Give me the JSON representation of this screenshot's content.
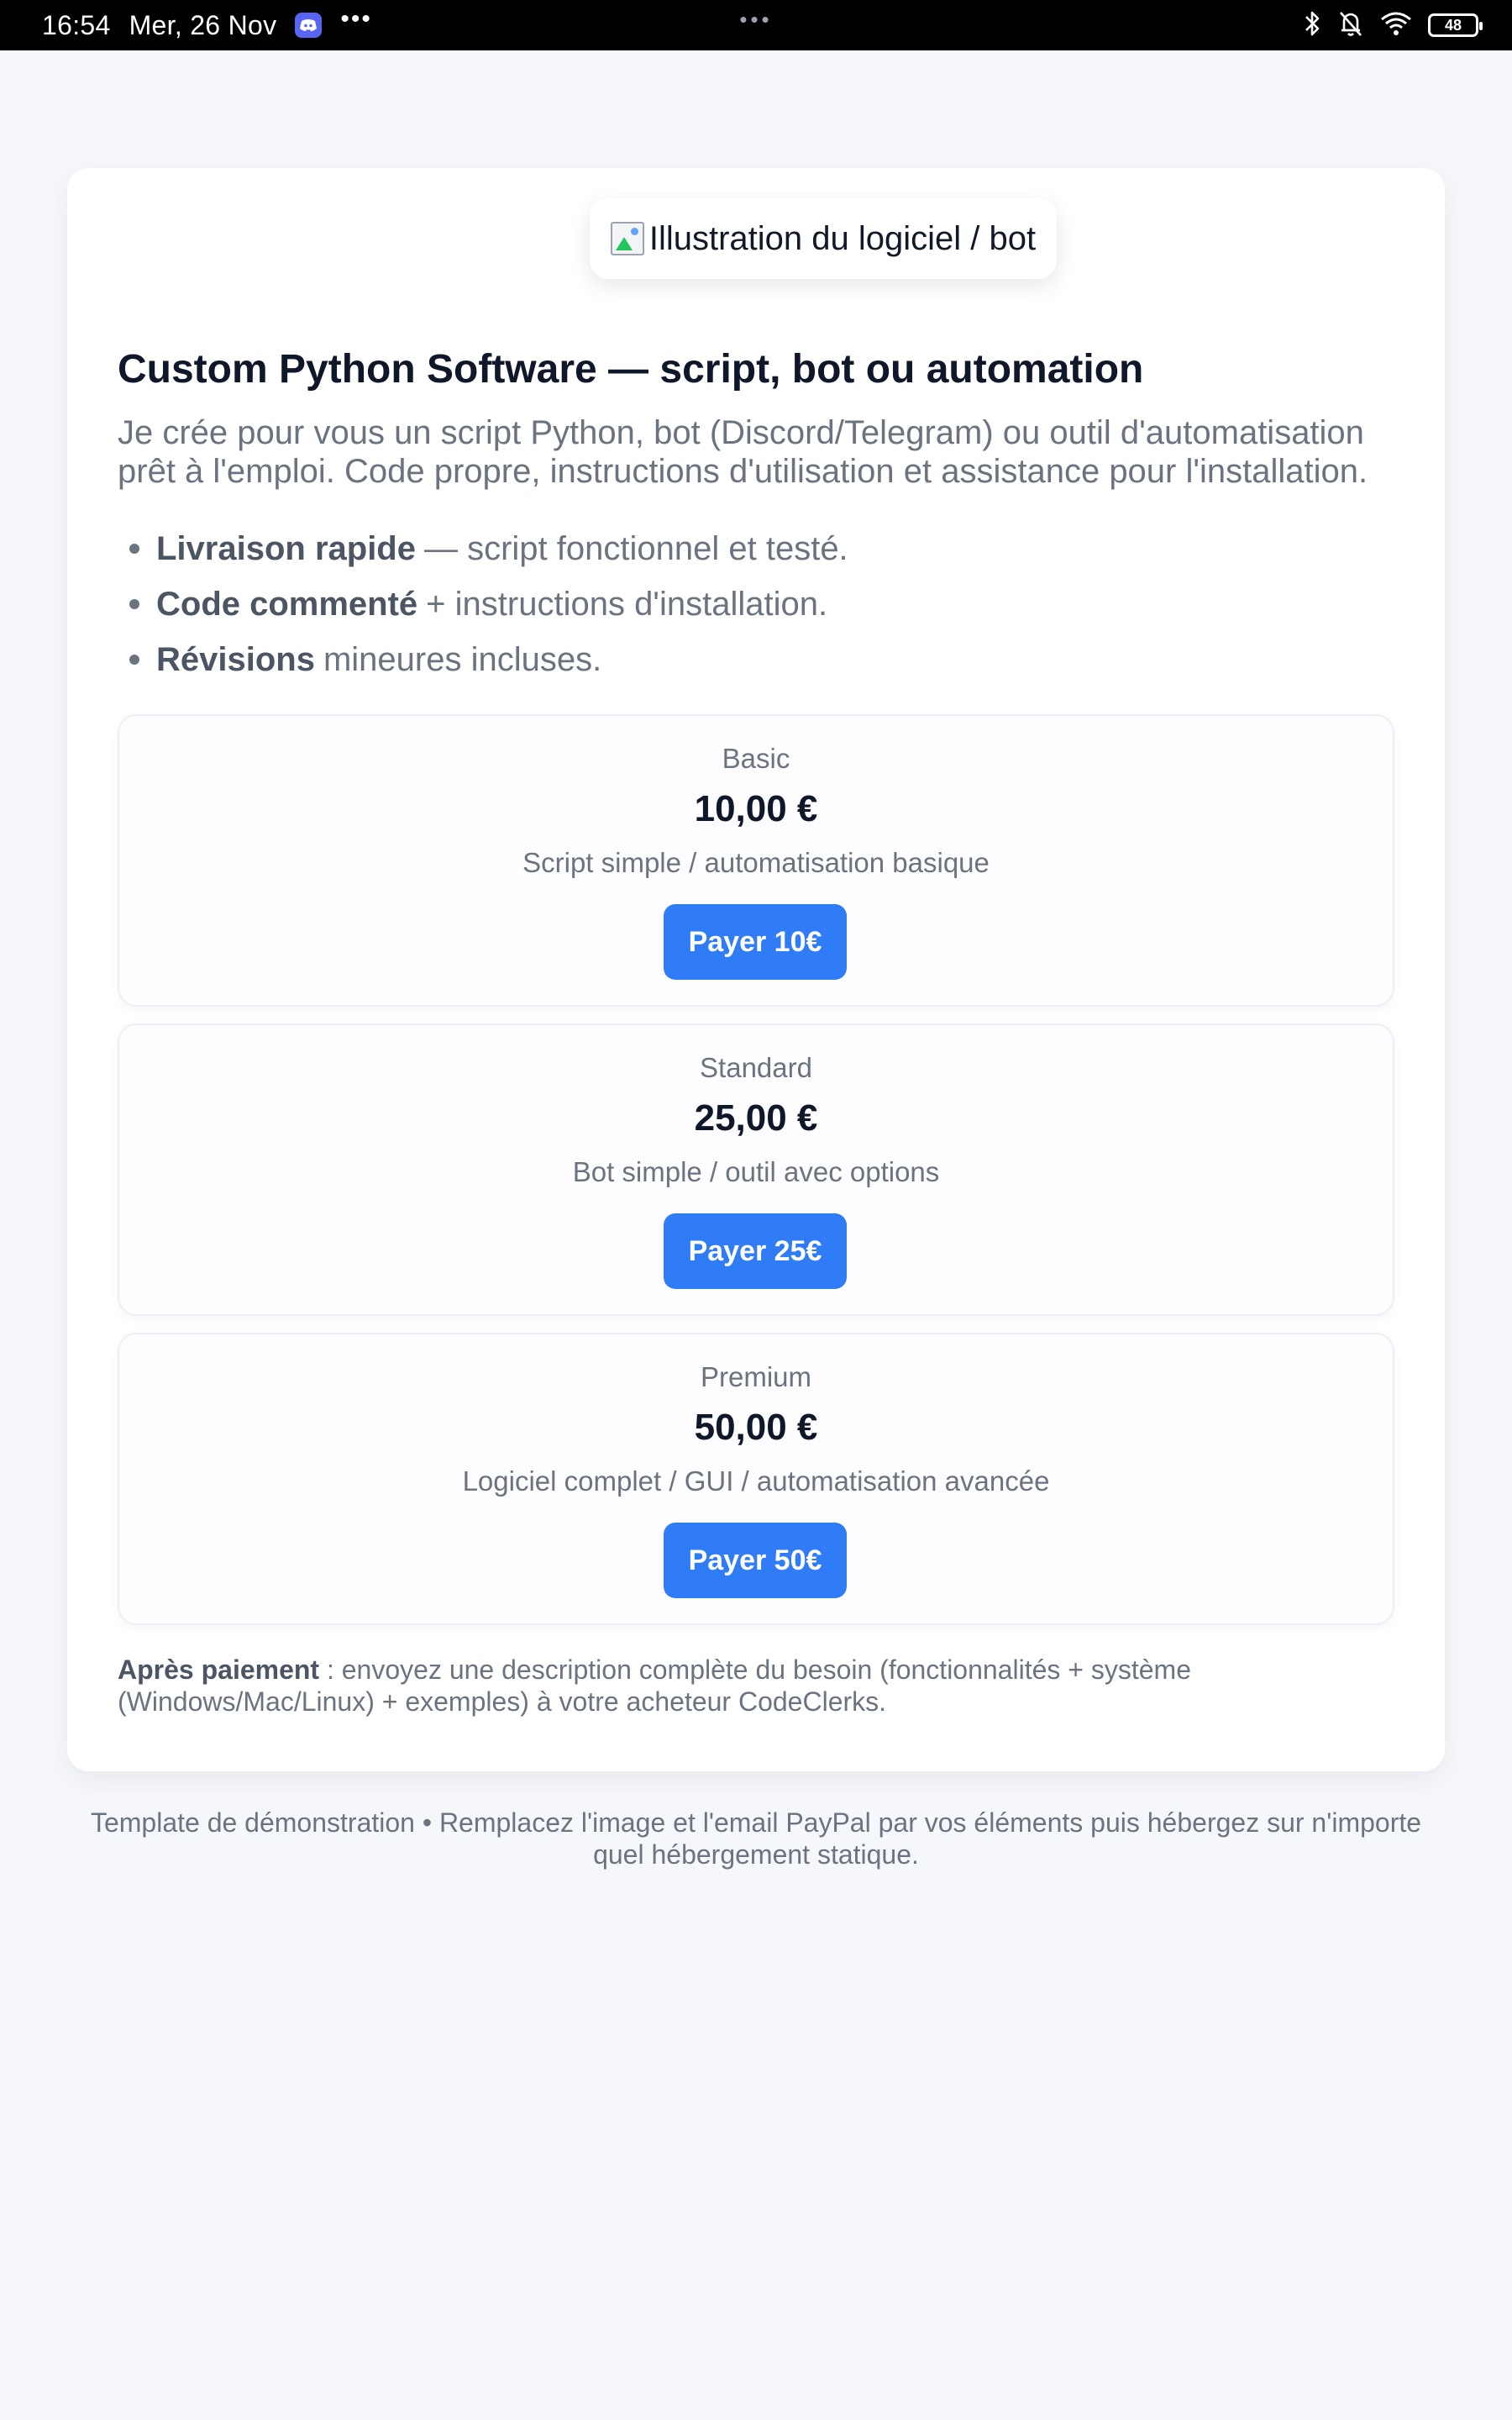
{
  "status_bar": {
    "time": "16:54",
    "date": "Mer, 26 Nov",
    "more_dots": "•••",
    "center_dots": "•••",
    "battery": "48"
  },
  "image": {
    "alt_text": "Illustration du logiciel / bot"
  },
  "header": {
    "title": "Custom Python Software — script, bot ou automation",
    "description": "Je crée pour vous un script Python, bot (Discord/Telegram) ou outil d'automatisation prêt à l'emploi. Code propre, instructions d'utilisation et assistance pour l'installation."
  },
  "features": [
    {
      "bold": "Livraison rapide",
      "text": "— script fonctionnel et testé."
    },
    {
      "bold": "Code commenté",
      "text": "+ instructions d'installation."
    },
    {
      "bold": "Révisions",
      "text": "mineures incluses."
    }
  ],
  "plans": [
    {
      "name": "Basic",
      "price": "10,00 €",
      "description": "Script simple / automatisation basique",
      "button": "Payer 10€"
    },
    {
      "name": "Standard",
      "price": "25,00 €",
      "description": "Bot simple / outil avec options",
      "button": "Payer 25€"
    },
    {
      "name": "Premium",
      "price": "50,00 €",
      "description": "Logiciel complet / GUI / automatisation avancée",
      "button": "Payer 50€"
    }
  ],
  "note": {
    "bold": "Après paiement",
    "text": ": envoyez une description complète du besoin (fonctionnalités + système (Windows/Mac/Linux) + exemples) à votre acheteur CodeClerks."
  },
  "footer": {
    "text": "Template de démonstration • Remplacez l'image et l'email PayPal par vos éléments puis hébergez sur n'importe quel hébergement statique."
  },
  "colors": {
    "accent": "#2f7cf6",
    "text_primary": "#0f172a",
    "text_muted": "#6b7280",
    "page_background": "#f6f7fb"
  }
}
